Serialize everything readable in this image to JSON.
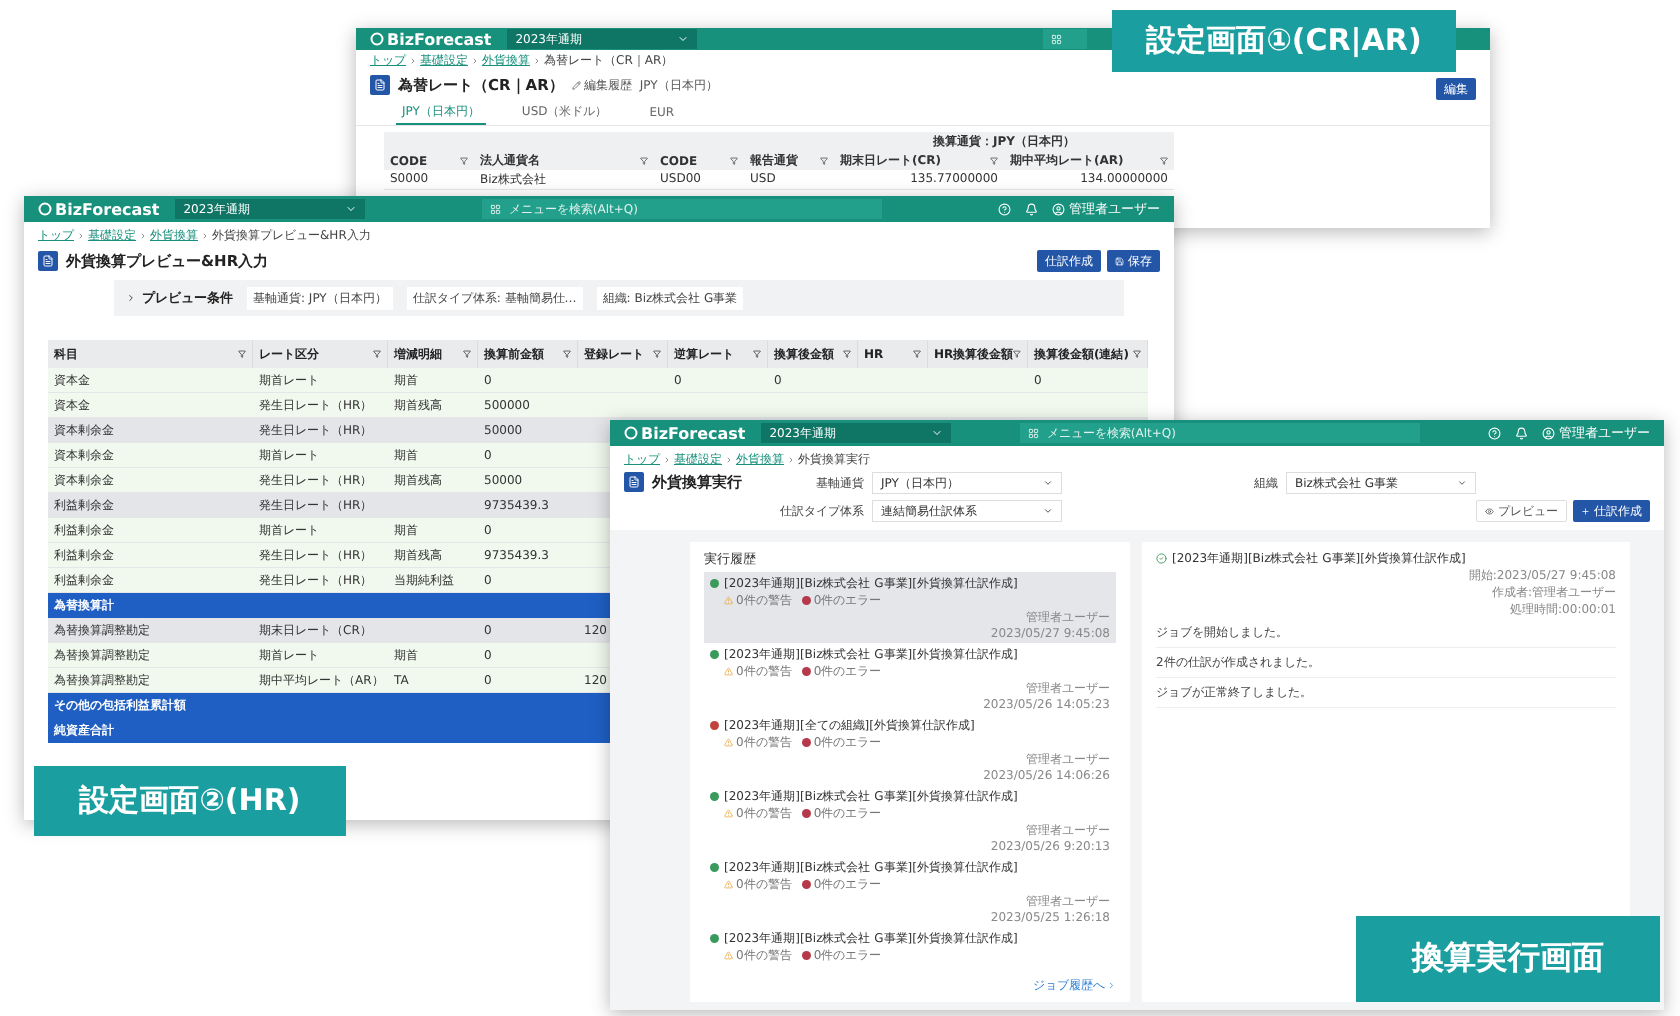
{
  "rate_screen": {
    "label": "設定画面①(CR|AR)",
    "header": {
      "brand": "BizForecast",
      "period": "2023年通期"
    },
    "breadcrumb": [
      "トップ",
      "基礎設定",
      "外貨換算",
      "為替レート（CR｜AR）"
    ],
    "title": "為替レート（CR｜AR）",
    "meta": [
      "編集履歴",
      "JPY（日本円）"
    ],
    "action": "編集",
    "tabs": [
      {
        "label": "JPY（日本円）",
        "selected": true
      },
      {
        "label": "USD（米ドル）",
        "selected": false
      },
      {
        "label": "EUR",
        "selected": false
      }
    ],
    "table": {
      "group_header": "換算通貨：JPY（日本円）",
      "columns": [
        "CODE",
        "法人通貨名",
        "CODE",
        "報告通貨",
        "期末日レート(CR)",
        "期中平均レート(AR)"
      ],
      "rows": [
        [
          "S0000",
          "Biz株式会社",
          "USD00",
          "USD",
          "135.77000000",
          "134.00000000"
        ]
      ]
    }
  },
  "preview_screen": {
    "label": "設定画面②(HR)",
    "header": {
      "brand": "BizForecast",
      "period": "2023年通期",
      "search_placeholder": "メニューを検索(Alt+Q)",
      "user": "管理者ユーザー"
    },
    "breadcrumb": [
      "トップ",
      "基礎設定",
      "外貨換算",
      "外貨換算プレビュー&HR入力"
    ],
    "title": "外貨換算プレビュー&HR入力",
    "actions": [
      "仕訳作成",
      "保存"
    ],
    "conditions": {
      "label": "プレビュー条件",
      "chips": [
        "基軸通貨: JPY（日本円）",
        "仕訳タイプ体系: 基軸簡易仕…",
        "組織: Biz株式会社 G事業"
      ]
    },
    "table": {
      "columns": [
        "科目",
        "レート区分",
        "増減明細",
        "換算前金額",
        "登録レート",
        "逆算レート",
        "換算後金額",
        "HR",
        "HR換算後金額",
        "換算後金額(連結)"
      ],
      "rows": [
        {
          "kind": "detail",
          "cells": [
            "資本金",
            "期首レート",
            "期首",
            "0",
            null,
            "0",
            "0",
            null,
            null,
            "0"
          ]
        },
        {
          "kind": "detail",
          "cells": [
            "資本金",
            "発生日レート（HR）",
            "期首残高",
            "500000"
          ]
        },
        {
          "kind": "subtotal",
          "cells": [
            "資本剰余金",
            "発生日レート（HR）",
            null,
            "50000"
          ]
        },
        {
          "kind": "detail",
          "cells": [
            "資本剰余金",
            "期首レート",
            "期首",
            "0"
          ]
        },
        {
          "kind": "detail",
          "cells": [
            "資本剰余金",
            "発生日レート（HR）",
            "期首残高",
            "50000"
          ]
        },
        {
          "kind": "subtotal",
          "cells": [
            "利益剰余金",
            "発生日レート（HR）",
            null,
            "9735439.3"
          ]
        },
        {
          "kind": "detail",
          "cells": [
            "利益剰余金",
            "期首レート",
            "期首",
            "0"
          ]
        },
        {
          "kind": "detail",
          "cells": [
            "利益剰余金",
            "発生日レート（HR）",
            "期首残高",
            "9735439.3"
          ]
        },
        {
          "kind": "detail",
          "cells": [
            "利益剰余金",
            "発生日レート（HR）",
            "当期純利益",
            "0"
          ]
        },
        {
          "kind": "section",
          "cells": [
            "為替換算計"
          ]
        },
        {
          "kind": "subtotal",
          "cells": [
            "為替換算調整勘定",
            "期末日レート（CR）",
            null,
            "0",
            "120"
          ]
        },
        {
          "kind": "detail",
          "cells": [
            "為替換算調整勘定",
            "期首レート",
            "期首",
            "0"
          ]
        },
        {
          "kind": "detail",
          "cells": [
            "為替換算調整勘定",
            "期中平均レート（AR）",
            "TA",
            "0",
            "120"
          ]
        },
        {
          "kind": "section",
          "cells": [
            "その他の包括利益累計額"
          ]
        },
        {
          "kind": "section",
          "cells": [
            "純資産合計"
          ]
        }
      ]
    }
  },
  "execution_screen": {
    "label": "換算実行画面",
    "header": {
      "brand": "BizForecast",
      "period": "2023年通期",
      "search_placeholder": "メニューを検索(Alt+Q)",
      "user": "管理者ユーザー"
    },
    "breadcrumb": [
      "トップ",
      "基礎設定",
      "外貨換算",
      "外貨換算実行"
    ],
    "title": "外貨換算実行",
    "form": [
      {
        "label": "基軸通貨",
        "value": "JPY（日本円）"
      },
      {
        "label": "組織",
        "value": "Biz株式会社 G事業"
      },
      {
        "label": "仕訳タイプ体系",
        "value": "連結簡易仕訳体系"
      }
    ],
    "actions": [
      "プレビュー",
      "仕訳作成"
    ],
    "history": {
      "title": "実行履歴",
      "link": "ジョブ履歴へ",
      "items": [
        {
          "title": "[2023年通期][Biz株式会社 G事業][外貨換算仕訳作成]",
          "color": "#3a9a5c",
          "selected": true,
          "warnings": "0件の警告",
          "errors": "0件のエラー",
          "user": "管理者ユーザー",
          "date": "2023/05/27 9:45:08"
        },
        {
          "title": "[2023年通期][Biz株式会社 G事業][外貨換算仕訳作成]",
          "color": "#3a9a5c",
          "selected": false,
          "warnings": "0件の警告",
          "errors": "0件のエラー",
          "user": "管理者ユーザー",
          "date": "2023/05/26 14:05:23"
        },
        {
          "title": "[2023年通期][全ての組織][外貨換算仕訳作成]",
          "color": "#c0443c",
          "selected": false,
          "warnings": "0件の警告",
          "errors": "0件のエラー",
          "user": "管理者ユーザー",
          "date": "2023/05/26 14:06:26"
        },
        {
          "title": "[2023年通期][Biz株式会社 G事業][外貨換算仕訳作成]",
          "color": "#3a9a5c",
          "selected": false,
          "warnings": "0件の警告",
          "errors": "0件のエラー",
          "user": "管理者ユーザー",
          "date": "2023/05/26 9:20:13"
        },
        {
          "title": "[2023年通期][Biz株式会社 G事業][外貨換算仕訳作成]",
          "color": "#3a9a5c",
          "selected": false,
          "warnings": "0件の警告",
          "errors": "0件のエラー",
          "user": "管理者ユーザー",
          "date": "2023/05/25 1:26:18"
        },
        {
          "title": "[2023年通期][Biz株式会社 G事業][外貨換算仕訳作成]",
          "color": "#3a9a5c",
          "selected": false,
          "warnings": "0件の警告",
          "errors": "0件のエラー"
        }
      ]
    },
    "detail": {
      "title": "[2023年通期][Biz株式会社 G事業][外貨換算仕訳作成]",
      "meta": [
        "開始:2023/05/27 9:45:08",
        "作成者:管理者ユーザー",
        "処理時間:00:00:01"
      ],
      "log": [
        "ジョブを開始しました。",
        "2件の仕訳が作成されました。",
        "ジョブが正常終了しました。"
      ]
    }
  }
}
